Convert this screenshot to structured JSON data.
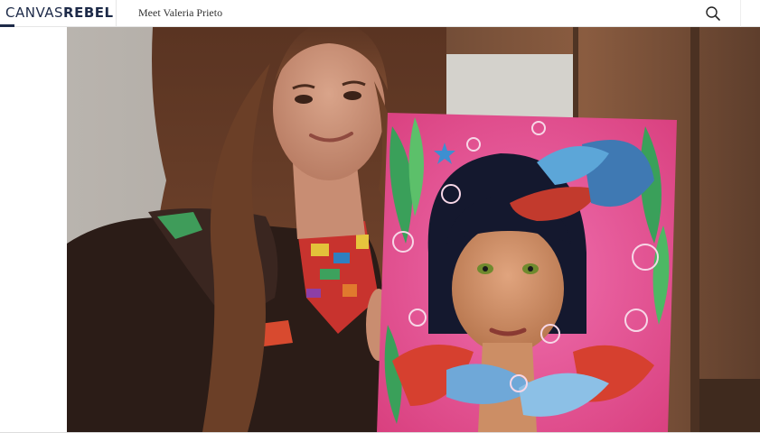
{
  "header": {
    "logo_light": "CANVAS",
    "logo_bold": "REBEL",
    "page_title": "Meet Valeria Prieto",
    "search_icon": "search-icon"
  },
  "hero_image": {
    "subject": "Valeria Prieto holding a painting"
  },
  "colors": {
    "brand_navy": "#1d2a48",
    "painting_pink": "#e8509a"
  }
}
